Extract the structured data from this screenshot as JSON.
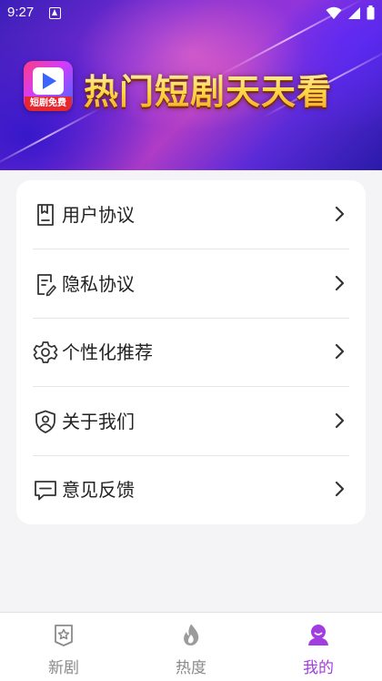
{
  "status_bar": {
    "time": "9:27"
  },
  "banner": {
    "logo_tag": "短剧免费",
    "title": "热门短剧天天看"
  },
  "menu": {
    "items": [
      {
        "label": "用户协议",
        "icon": "document-icon"
      },
      {
        "label": "隐私协议",
        "icon": "edit-document-icon"
      },
      {
        "label": "个性化推荐",
        "icon": "gear-icon"
      },
      {
        "label": "关于我们",
        "icon": "shield-user-icon"
      },
      {
        "label": "意见反馈",
        "icon": "chat-icon"
      }
    ]
  },
  "bottom_nav": {
    "items": [
      {
        "label": "新剧",
        "icon": "star-badge-icon",
        "active": false
      },
      {
        "label": "热度",
        "icon": "flame-icon",
        "active": false
      },
      {
        "label": "我的",
        "icon": "user-icon",
        "active": true
      }
    ]
  },
  "colors": {
    "accent": "#a23ee0",
    "inactive": "#8a8a8a"
  }
}
